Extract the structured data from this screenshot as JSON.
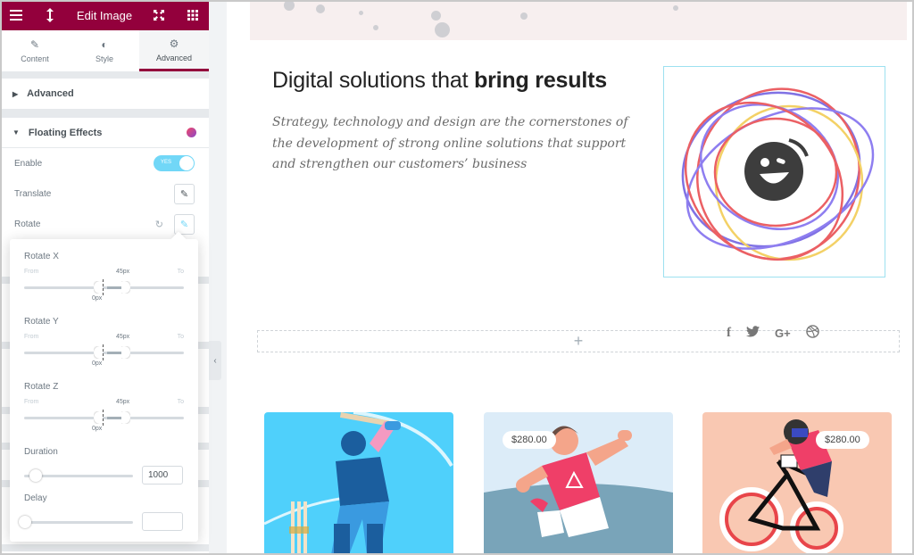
{
  "panel": {
    "title": "Edit Image",
    "icons": {
      "menu": "hamburger-icon",
      "resize": "vertical-arrows-icon",
      "fullscreen": "expand-icon",
      "widgets": "grid-icon"
    },
    "tabs": [
      {
        "label": "Content",
        "icon": "pencil-icon",
        "active": false
      },
      {
        "label": "Style",
        "icon": "half-circle-icon",
        "active": false
      },
      {
        "label": "Advanced",
        "icon": "gear-icon",
        "active": true
      }
    ],
    "sections": {
      "advanced": "Advanced",
      "floating": "Floating Effects"
    },
    "controls": {
      "enable_label": "Enable",
      "enable_toggle": "YES",
      "enable_on": true,
      "translate_label": "Translate",
      "rotate_label": "Rotate"
    },
    "accent": "#93003c"
  },
  "popup": {
    "rotate_x": {
      "label": "Rotate X",
      "from_label": "From",
      "to_label": "To",
      "from_value": "0px",
      "to_value": "45px"
    },
    "rotate_y": {
      "label": "Rotate Y",
      "from_label": "From",
      "to_label": "To",
      "from_value": "0px",
      "to_value": "45px"
    },
    "rotate_z": {
      "label": "Rotate Z",
      "from_label": "From",
      "to_label": "To",
      "from_value": "0px",
      "to_value": "45px"
    },
    "duration": {
      "label": "Duration",
      "value": "1000"
    },
    "delay": {
      "label": "Delay",
      "value": ""
    }
  },
  "canvas": {
    "heading_light": "Digital solutions that ",
    "heading_bold": "bring results",
    "paragraph": "Strategy, technology and design are the cornerstones of the development of strong online solutions that support and strengthen our customers’ business",
    "add_section": "+",
    "social": [
      "facebook-icon",
      "twitter-icon",
      "google-plus-icon",
      "dribbble-icon"
    ],
    "social_glyphs": [
      "f",
      "ὂ6",
      "G+",
      "◎"
    ],
    "cards": [
      {
        "name": "cricket",
        "price": "",
        "bg": "#4fd0fb"
      },
      {
        "name": "soccer",
        "price": "$280.00",
        "bg": "#dcecf8"
      },
      {
        "name": "bike",
        "price": "$280.00",
        "bg": "#f9c8b2"
      }
    ]
  }
}
